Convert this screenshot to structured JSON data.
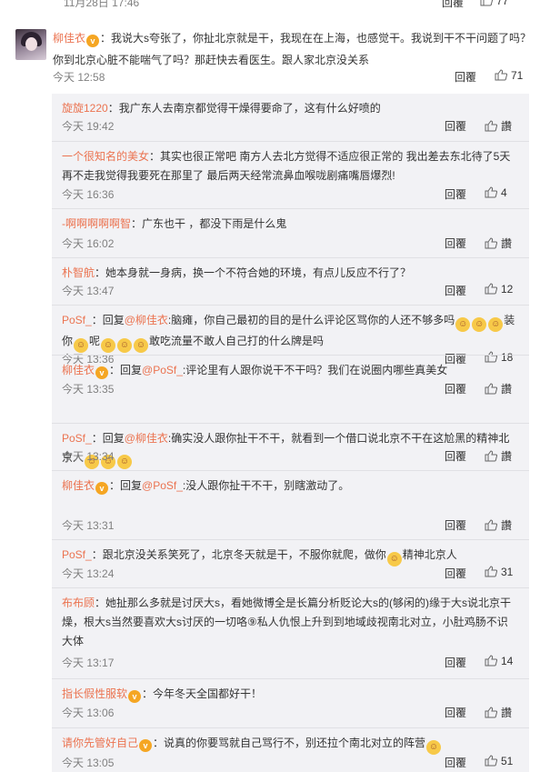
{
  "top_row": {
    "time": "11月28日 17:46",
    "reply": "回覆",
    "likes": "77"
  },
  "main_comment": {
    "user": "柳佳衣",
    "text": "：我说大s夸张了，你扯北京就是干，我现在在上海，也感觉干。我说到干不干问题了吗？你到北京心脏不能喘气了吗？那赶快去看医生。跟人家北京没关系",
    "time": "今天 12:58",
    "reply": "回覆",
    "likes": "71"
  },
  "replies": [
    {
      "segments": [
        {
          "t": "user",
          "v": "旋旋1220"
        },
        {
          "t": "text",
          "v": "：我广东人去南京都觉得干燥得要命了，这有什么好喷的"
        }
      ],
      "time": "今天 19:42",
      "reply": "回覆",
      "likes": "讚"
    },
    {
      "segments": [
        {
          "t": "user",
          "v": "一个很知名的美女"
        },
        {
          "t": "text",
          "v": "：其实也很正常吧 南方人去北方觉得不适应很正常的 我出差去东北待了5天再不走我觉得我要死在那里了 最后两天经常流鼻血喉咙剧痛嘴唇爆烈!"
        }
      ],
      "time": "今天 16:36",
      "reply": "回覆",
      "likes": "4"
    },
    {
      "segments": [
        {
          "t": "user",
          "v": "-啊啊啊啊啊智"
        },
        {
          "t": "text",
          "v": "：广东也干 ，都没下雨是什么鬼"
        }
      ],
      "time": "今天 16:02",
      "reply": "回覆",
      "likes": "讚"
    },
    {
      "segments": [
        {
          "t": "user",
          "v": "朴智航"
        },
        {
          "t": "text",
          "v": "：她本身就一身病，换一个不符合她的环境，有点儿反应不行了？"
        }
      ],
      "time": "今天 13:47",
      "reply": "回覆",
      "likes": "12"
    },
    {
      "segments": [
        {
          "t": "user",
          "v": "PoSf_"
        },
        {
          "t": "text",
          "v": "：回复"
        },
        {
          "t": "user",
          "v": "@柳佳衣"
        },
        {
          "t": "text",
          "v": ":脑瘫，你自己最初的目的是什么评论区骂你的人还不够多吗"
        },
        {
          "t": "emoji"
        },
        {
          "t": "emoji"
        },
        {
          "t": "emoji"
        },
        {
          "t": "text",
          "v": "装你"
        },
        {
          "t": "emoji"
        },
        {
          "t": "text",
          "v": "呢"
        },
        {
          "t": "emoji"
        },
        {
          "t": "emoji"
        },
        {
          "t": "emoji"
        },
        {
          "t": "text",
          "v": "敢吃流量不敢人自己打的什么牌是吗"
        }
      ],
      "time": "今天 13:36",
      "reply": "回覆",
      "likes": "18"
    },
    {
      "segments": [
        {
          "t": "user",
          "v": "柳佳衣"
        },
        {
          "t": "badge"
        },
        {
          "t": "text",
          "v": "：回复"
        },
        {
          "t": "user",
          "v": "@PoSf_"
        },
        {
          "t": "text",
          "v": ":评论里有人跟你说干不干吗？我们在说圈内哪些真美女"
        }
      ],
      "time": "今天 13:35",
      "reply": "回覆",
      "likes": "讚"
    },
    {
      "segments": [
        {
          "t": "user",
          "v": "PoSf_"
        },
        {
          "t": "text",
          "v": "：回复"
        },
        {
          "t": "user",
          "v": "@柳佳衣"
        },
        {
          "t": "text",
          "v": ":确实没人跟你扯干不干，就看到一个借口说北京不干在这尬黑的精神北京人"
        },
        {
          "t": "emoji"
        },
        {
          "t": "emoji"
        },
        {
          "t": "emoji"
        }
      ],
      "time": "今天 13:34",
      "reply": "回覆",
      "likes": "讚"
    },
    {
      "segments": [
        {
          "t": "user",
          "v": "柳佳衣"
        },
        {
          "t": "badge"
        },
        {
          "t": "text",
          "v": "：回复"
        },
        {
          "t": "user",
          "v": "@PoSf_"
        },
        {
          "t": "text",
          "v": ":没人跟你扯干不干，别瞎激动了。"
        }
      ],
      "time": "今天 13:31",
      "reply": "回覆",
      "likes": "讚"
    },
    {
      "segments": [
        {
          "t": "user",
          "v": "PoSf_"
        },
        {
          "t": "text",
          "v": "：跟北京没关系笑死了，北京冬天就是干，不服你就爬，做你"
        },
        {
          "t": "emoji"
        },
        {
          "t": "text",
          "v": "精神北京人"
        }
      ],
      "time": "今天 13:24",
      "reply": "回覆",
      "likes": "31"
    },
    {
      "segments": [
        {
          "t": "user",
          "v": "布布顾"
        },
        {
          "t": "text",
          "v": "：她扯那么多就是讨厌大s，看她微博全是长篇分析贬论大s的(够闲的)缘于大s说北京干燥，根大s当然要喜欢大s讨厌的一切咯⑨私人仇恨上升到到地域歧视南北对立，小肚鸡肠不识大体"
        }
      ],
      "time": "今天 13:17",
      "reply": "回覆",
      "likes": "14"
    },
    {
      "segments": [
        {
          "t": "user",
          "v": "指长假性服软"
        },
        {
          "t": "badge"
        },
        {
          "t": "text",
          "v": "：今年冬天全国都好干！"
        }
      ],
      "time": "今天 13:06",
      "reply": "回覆",
      "likes": "讚"
    },
    {
      "segments": [
        {
          "t": "user",
          "v": "请你先管好自己"
        },
        {
          "t": "badge"
        },
        {
          "t": "text",
          "v": "：说真的你要骂就自己骂行不，别还拉个南北对立的阵营"
        },
        {
          "t": "emoji"
        }
      ],
      "time": "今天 13:05",
      "reply": "回覆",
      "likes": "51"
    }
  ],
  "colors": {
    "username": "#eb7350",
    "time": "#808080",
    "sub_bg": "#f2f2f5"
  },
  "icons": {
    "like": "thumbs-up-icon",
    "vip": "vip-badge-icon",
    "emoji": "emoji-icon"
  }
}
